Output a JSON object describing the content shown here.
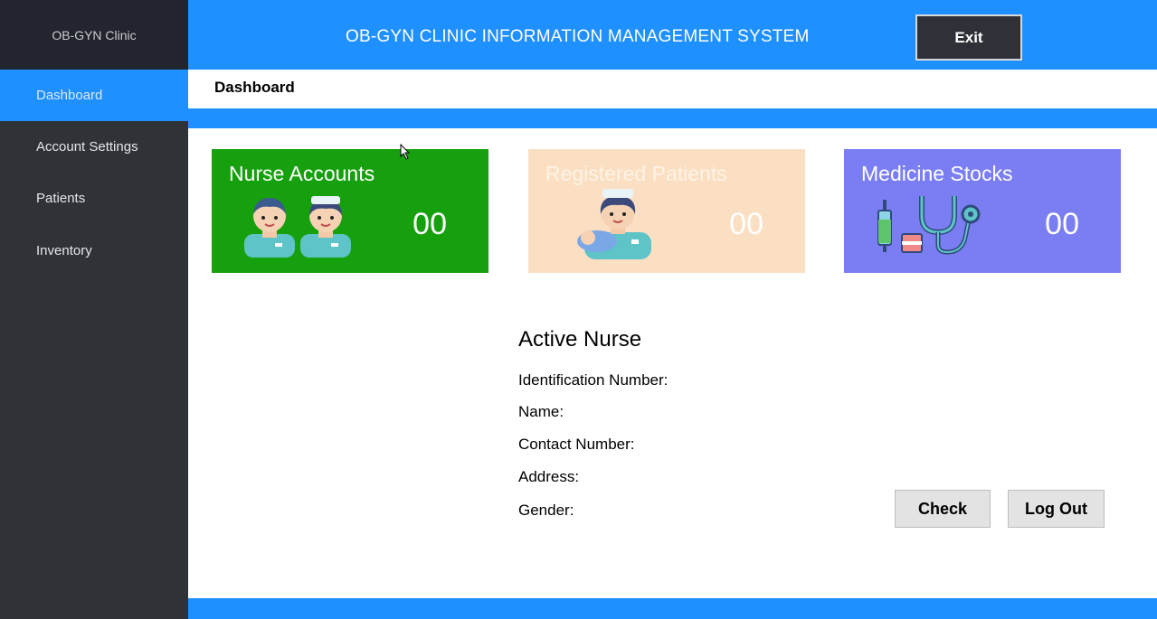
{
  "sidebar": {
    "brand": "OB-GYN Clinic",
    "items": [
      {
        "label": "Dashboard",
        "active": true
      },
      {
        "label": "Account Settings",
        "active": false
      },
      {
        "label": "Patients",
        "active": false
      },
      {
        "label": "Inventory",
        "active": false
      }
    ]
  },
  "header": {
    "title": "OB-GYN CLINIC INFORMATION MANAGEMENT SYSTEM",
    "exit_label": "Exit"
  },
  "subheader": {
    "title": "Dashboard"
  },
  "cards": [
    {
      "title": "Nurse Accounts",
      "count": "00",
      "icon": "nurses-icon",
      "color": "#17a00e"
    },
    {
      "title": "Registered Patients",
      "count": "00",
      "icon": "nurse-with-baby-icon",
      "color": "#fbdfc2"
    },
    {
      "title": "Medicine Stocks",
      "count": "00",
      "icon": "medical-supplies-icon",
      "color": "#7b7ef2"
    }
  ],
  "active_nurse": {
    "title": "Active Nurse",
    "fields": {
      "id": "Identification Number:",
      "name": "Name:",
      "contact": "Contact Number:",
      "address": "Address:",
      "gender": "Gender:"
    }
  },
  "actions": {
    "check_label": "Check",
    "logout_label": "Log Out"
  },
  "colors": {
    "accent": "#1e90ff",
    "sidebar": "#2f3338",
    "brand_bg": "#22252e"
  }
}
